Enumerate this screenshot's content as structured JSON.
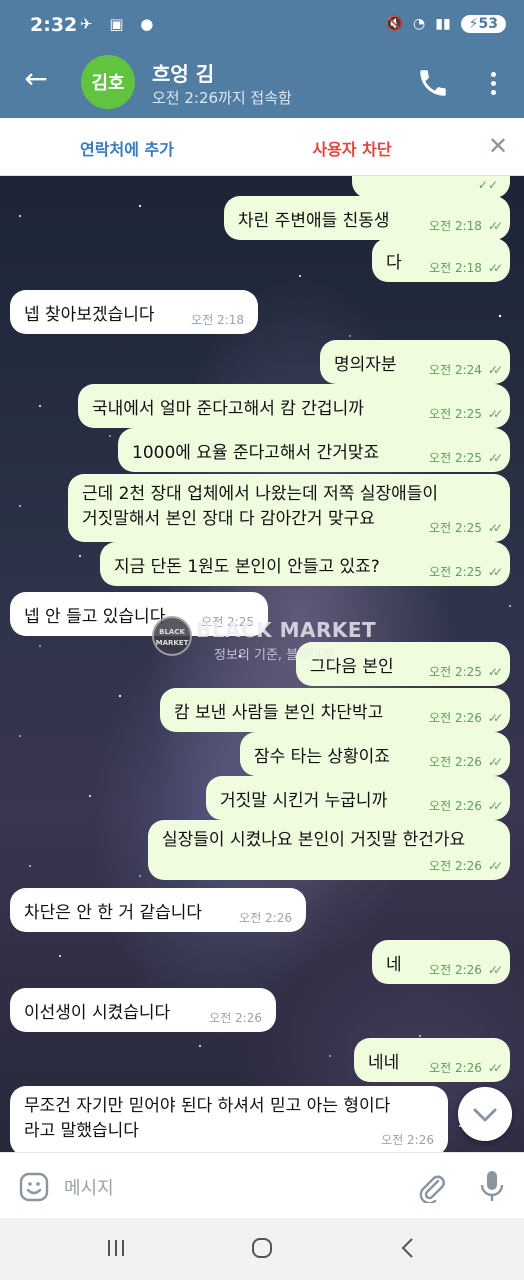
{
  "status_bar": {
    "time": "2:32",
    "battery": "53"
  },
  "header": {
    "avatar_initials": "김호",
    "name": "흐엉 김",
    "status": "오전 2:26까지 접속함"
  },
  "action_bar": {
    "add_contact": "연락처에 추가",
    "block_user": "사용자 차단"
  },
  "messages": [
    {
      "text": "차린 주변애들 친동생",
      "time": "오전 2:18",
      "dir": "out"
    },
    {
      "text": "다",
      "time": "오전 2:18",
      "dir": "out"
    },
    {
      "text": "넵 찾아보겠습니다",
      "time": "오전 2:18",
      "dir": "in"
    },
    {
      "text": "명의자분",
      "time": "오전 2:24",
      "dir": "out"
    },
    {
      "text": "국내에서 얼마 준다고해서 캄 간겁니까",
      "time": "오전 2:25",
      "dir": "out"
    },
    {
      "text": "1000에 요율 준다고해서 간거맞죠",
      "time": "오전 2:25",
      "dir": "out"
    },
    {
      "text_line1": "근데 2천 장대 업체에서 나왔는데 저쪽 실장애들이",
      "text_line2": "거짓말해서 본인 장대 다 감아간거 맞구요",
      "time": "오전 2:25",
      "dir": "out"
    },
    {
      "text": "지금 단돈 1원도 본인이 안들고 있죠?",
      "time": "오전 2:25",
      "dir": "out"
    },
    {
      "text": "넵 안 들고 있습니다",
      "time": "오전 2:25",
      "dir": "in"
    },
    {
      "text": "그다음 본인",
      "time": "오전 2:25",
      "dir": "out"
    },
    {
      "text": "캄 보낸 사람들 본인 차단박고",
      "time": "오전 2:26",
      "dir": "out"
    },
    {
      "text": "잠수 타는 상황이죠",
      "time": "오전 2:26",
      "dir": "out"
    },
    {
      "text": "거짓말 시킨거 누굽니까",
      "time": "오전 2:26",
      "dir": "out"
    },
    {
      "text": "실장들이 시켰나요 본인이 거짓말 한건가요",
      "time": "오전 2:26",
      "dir": "out"
    },
    {
      "text": "차단은 안 한 거 같습니다",
      "time": "오전 2:26",
      "dir": "in"
    },
    {
      "text": "네",
      "time": "오전 2:26",
      "dir": "out"
    },
    {
      "text": "이선생이 시켰습니다",
      "time": "오전 2:26",
      "dir": "in"
    },
    {
      "text": "네네",
      "time": "오전 2:26",
      "dir": "out"
    },
    {
      "text_line1": "무조건 자기만 믿어야 된다 하셔서 믿고 아는 형이다",
      "text_line2": "라고 말했습니다",
      "time": "오전 2:26",
      "dir": "in"
    }
  ],
  "watermark": {
    "logo_text": "BLACK MARKET",
    "title": "BLACK MARKET",
    "subtitle": "정보의 기준, 블랙마켓"
  },
  "input": {
    "placeholder": "메시지"
  },
  "colors": {
    "header": "#517da2",
    "outgoing_bubble": "#effdde",
    "incoming_bubble": "#ffffff",
    "read_ticks": "#5fa15a",
    "block_red": "#e0473f",
    "link_blue": "#3a7bbf"
  }
}
